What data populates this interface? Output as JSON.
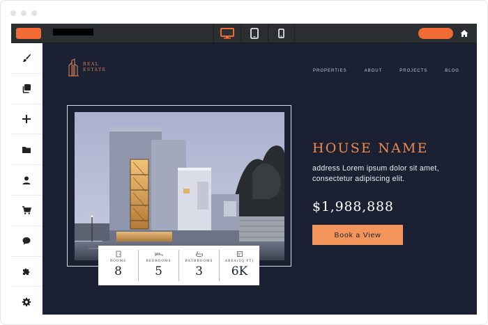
{
  "colors": {
    "accent": "#f26a35",
    "site_background": "#1b2032",
    "heading_accent": "#f08a4b",
    "button": "#f3955a"
  },
  "editor": {
    "devices": [
      {
        "name": "desktop",
        "icon": "desktop-icon",
        "active": true
      },
      {
        "name": "tablet",
        "icon": "tablet-icon",
        "active": false
      },
      {
        "name": "mobile",
        "icon": "mobile-icon",
        "active": false
      }
    ],
    "sidebar_icons": [
      "brush-icon",
      "copy-icon",
      "plus-icon",
      "folder-icon",
      "user-icon",
      "cart-icon",
      "chat-icon",
      "puzzle-icon",
      "gear-icon"
    ]
  },
  "site": {
    "brand": {
      "line1": "REAL",
      "line2": "ESTATE"
    },
    "nav": [
      "PROPERTIES",
      "ABOUT",
      "PROJECTS",
      "BLOG"
    ],
    "house_name": "HOUSE NAME",
    "address": "address Lorem ipsum dolor sit amet, consectetur adipiscing elit.",
    "price": "$1,988,888",
    "cta": "Book a View",
    "stats": [
      {
        "label": "ROOMS",
        "value": "8",
        "icon": "door-icon"
      },
      {
        "label": "BEDROOMS",
        "value": "5",
        "icon": "bed-icon"
      },
      {
        "label": "BATHROOMS",
        "value": "3",
        "icon": "bath-icon"
      },
      {
        "label": "AREA(SQ FT)",
        "value": "6K",
        "icon": "area-icon"
      }
    ]
  }
}
